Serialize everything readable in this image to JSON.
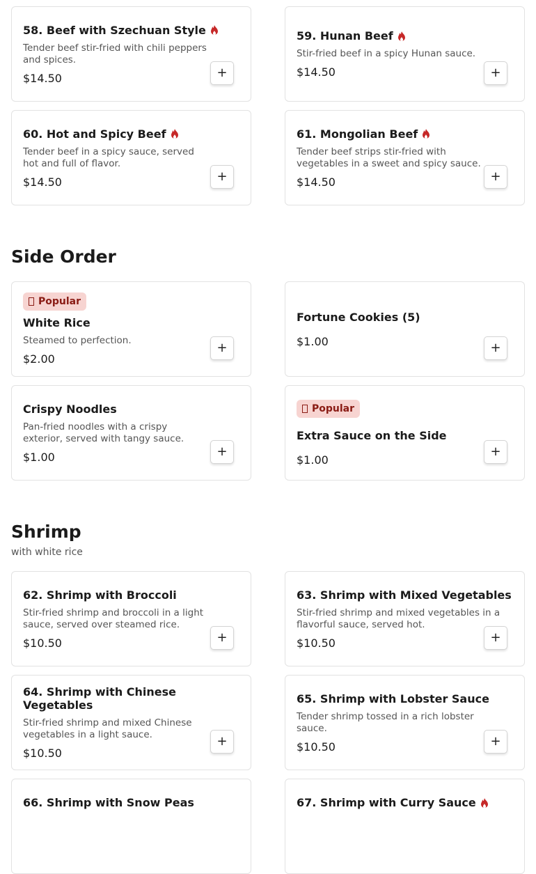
{
  "colors": {
    "spicy": "#c62828",
    "popular_bg": "#f7d4d1",
    "popular_text": "#8a1b14"
  },
  "add_label": "+",
  "popular_label": "Popular",
  "beef_items": [
    {
      "title": "58. Beef with Szechuan Style",
      "desc": "Tender beef stir-fried with chili peppers and spices.",
      "price": "$14.50",
      "spicy": true
    },
    {
      "title": "59. Hunan Beef",
      "desc": "Stir-fried beef in a spicy Hunan sauce.",
      "price": "$14.50",
      "spicy": true
    },
    {
      "title": "60. Hot and Spicy Beef",
      "desc": "Tender beef in a spicy sauce, served hot and full of flavor.",
      "price": "$14.50",
      "spicy": true
    },
    {
      "title": "61. Mongolian Beef",
      "desc": "Tender beef strips stir-fried with vegetables in a sweet and spicy sauce.",
      "price": "$14.50",
      "spicy": true
    }
  ],
  "side_order": {
    "title": "Side Order",
    "items": [
      {
        "title": "White Rice",
        "desc": "Steamed to perfection.",
        "price": "$2.00",
        "popular": true
      },
      {
        "title": "Fortune Cookies (5)",
        "desc": "",
        "price": "$1.00",
        "popular": false
      },
      {
        "title": "Crispy Noodles",
        "desc": "Pan-fried noodles with a crispy exterior, served with tangy sauce.",
        "price": "$1.00",
        "popular": false
      },
      {
        "title": "Extra Sauce on the Side",
        "desc": "",
        "price": "$1.00",
        "popular": true
      }
    ]
  },
  "shrimp": {
    "title": "Shrimp",
    "subtitle": "with white rice",
    "items": [
      {
        "title": "62. Shrimp with Broccoli",
        "desc": "Stir-fried shrimp and broccoli in a light sauce, served over steamed rice.",
        "price": "$10.50"
      },
      {
        "title": "63. Shrimp with Mixed Vegetables",
        "desc": "Stir-fried shrimp and mixed vegetables in a flavorful sauce, served hot.",
        "price": "$10.50"
      },
      {
        "title": "64. Shrimp with Chinese Vegetables",
        "desc": "Stir-fried shrimp and mixed Chinese vegetables in a light sauce.",
        "price": "$10.50"
      },
      {
        "title": "65. Shrimp with Lobster Sauce",
        "desc": "Tender shrimp tossed in a rich lobster sauce.",
        "price": "$10.50"
      },
      {
        "title": "66. Shrimp with Snow Peas",
        "desc": "",
        "price": ""
      },
      {
        "title": "67. Shrimp with Curry Sauce",
        "desc": "",
        "price": "",
        "spicy": true
      }
    ]
  }
}
